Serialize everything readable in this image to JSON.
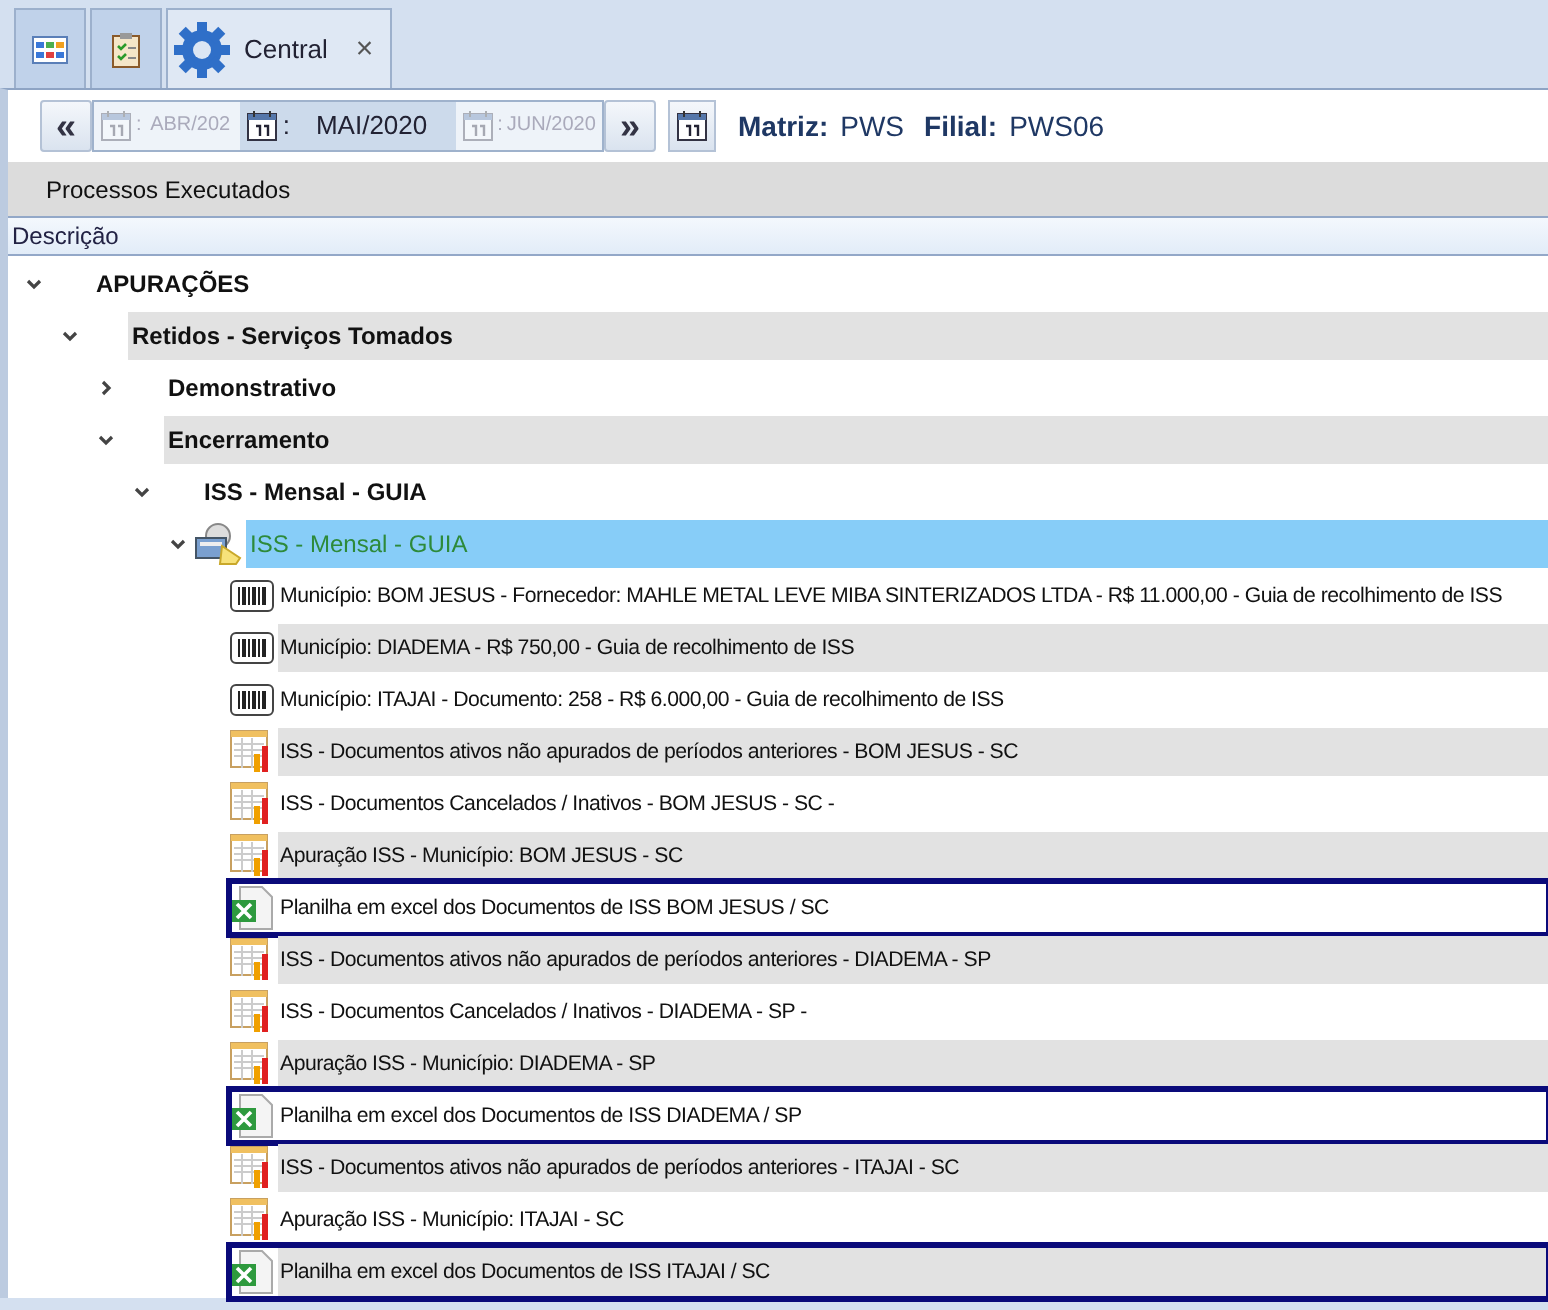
{
  "tabs": [
    {
      "kind": "grid",
      "selected": false
    },
    {
      "kind": "checklist",
      "selected": false
    },
    {
      "kind": "gear",
      "label": "Central",
      "close": "×",
      "selected": true
    }
  ],
  "period_nav": {
    "prev": "«",
    "next": "»",
    "months": [
      {
        "separator": ":",
        "label": "ABR/202",
        "selected": false
      },
      {
        "separator": ":",
        "label": "MAI/2020",
        "selected": true
      },
      {
        "separator": ":",
        "label": "JUN/2020",
        "selected": false
      }
    ]
  },
  "company_fields": [
    {
      "label": "Matriz:",
      "value": "PWS"
    },
    {
      "label": "Filial:",
      "value": "PWS06"
    }
  ],
  "section_title": "Processos Executados",
  "column_header": "Descrição",
  "tree": [
    {
      "label": "APURAÇÕES",
      "kind": "group",
      "expanded": true,
      "selected": false,
      "highlighted": false,
      "children": [
        {
          "label": "Retidos - Serviços Tomados",
          "kind": "group",
          "expanded": true,
          "selected": false,
          "highlighted": false,
          "children": [
            {
              "label": "Demonstrativo",
              "kind": "group",
              "expanded": false,
              "selected": false,
              "highlighted": false
            },
            {
              "label": "Encerramento",
              "kind": "group",
              "expanded": true,
              "selected": false,
              "highlighted": false,
              "children": [
                {
                  "label": "ISS - Mensal - GUIA",
                  "kind": "group",
                  "expanded": true,
                  "selected": false,
                  "highlighted": false,
                  "children": [
                    {
                      "label": "ISS - Mensal - GUIA",
                      "kind": "process",
                      "expanded": true,
                      "selected": true,
                      "highlighted": false,
                      "children": [
                        {
                          "label": "Município: BOM JESUS - Fornecedor: MAHLE METAL LEVE MIBA SINTERIZADOS LTDA - R$ 11.000,00 - Guia de recolhimento de ISS",
                          "kind": "barcode",
                          "selected": false,
                          "highlighted": false
                        },
                        {
                          "label": "Município: DIADEMA - R$ 750,00 - Guia de recolhimento de ISS",
                          "kind": "barcode",
                          "selected": false,
                          "highlighted": false
                        },
                        {
                          "label": "Município: ITAJAI - Documento: 258 - R$ 6.000,00 - Guia de recolhimento de ISS",
                          "kind": "barcode",
                          "selected": false,
                          "highlighted": false
                        },
                        {
                          "label": "ISS - Documentos ativos não apurados de períodos anteriores - BOM JESUS - SC",
                          "kind": "report",
                          "selected": false,
                          "highlighted": false
                        },
                        {
                          "label": "ISS - Documentos Cancelados / Inativos - BOM JESUS - SC -",
                          "kind": "report",
                          "selected": false,
                          "highlighted": false
                        },
                        {
                          "label": "Apuração ISS - Município: BOM JESUS - SC",
                          "kind": "report",
                          "selected": false,
                          "highlighted": false
                        },
                        {
                          "label": "Planilha em excel dos Documentos de ISS BOM JESUS / SC",
                          "kind": "spreadsheet",
                          "selected": false,
                          "highlighted": true
                        },
                        {
                          "label": "ISS - Documentos ativos não apurados de períodos anteriores - DIADEMA - SP",
                          "kind": "report",
                          "selected": false,
                          "highlighted": false
                        },
                        {
                          "label": "ISS - Documentos Cancelados / Inativos - DIADEMA - SP -",
                          "kind": "report",
                          "selected": false,
                          "highlighted": false
                        },
                        {
                          "label": "Apuração ISS - Município: DIADEMA - SP",
                          "kind": "report",
                          "selected": false,
                          "highlighted": false
                        },
                        {
                          "label": "Planilha em excel dos Documentos de ISS DIADEMA / SP",
                          "kind": "spreadsheet",
                          "selected": false,
                          "highlighted": true
                        },
                        {
                          "label": "ISS - Documentos ativos não apurados de períodos anteriores - ITAJAI - SC",
                          "kind": "report",
                          "selected": false,
                          "highlighted": false
                        },
                        {
                          "label": "Apuração ISS - Município: ITAJAI - SC",
                          "kind": "report",
                          "selected": false,
                          "highlighted": false
                        },
                        {
                          "label": "Planilha em excel dos Documentos de ISS ITAJAI / SC",
                          "kind": "spreadsheet",
                          "selected": false,
                          "highlighted": true
                        }
                      ]
                    }
                  ]
                }
              ]
            }
          ]
        }
      ]
    }
  ]
}
